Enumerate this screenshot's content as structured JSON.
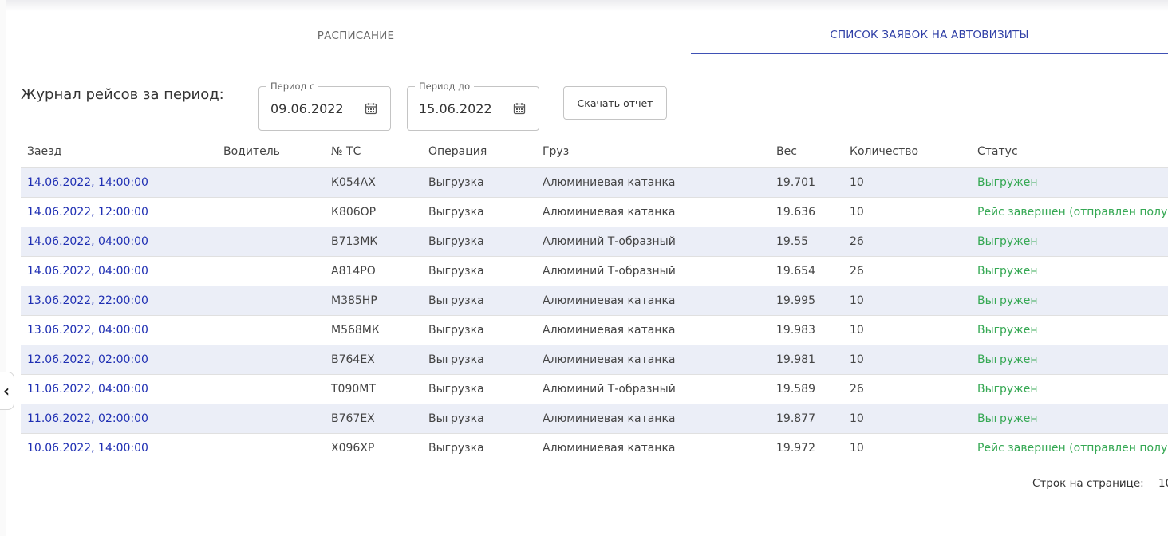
{
  "tabs": [
    {
      "label": "РАСПИСАНИЕ"
    },
    {
      "label": "СПИСОК ЗАЯВОК НА АВТОВИЗИТЫ"
    }
  ],
  "journal": {
    "title": "Журнал рейсов за период:"
  },
  "period_from": {
    "label": "Период с",
    "value": "09.06.2022"
  },
  "period_to": {
    "label": "Период до",
    "value": "15.06.2022"
  },
  "download_label": "Скачать отчет",
  "table": {
    "headers": [
      "Заезд",
      "Водитель",
      "№ ТС",
      "Операция",
      "Груз",
      "Вес",
      "Количество",
      "Статус"
    ],
    "rows": [
      {
        "arrival": "14.06.2022, 14:00:00",
        "driver": "",
        "vehicle": "К054АХ",
        "operation": "Выгрузка",
        "cargo": "Алюминиевая катанка",
        "weight": "19.701",
        "quantity": "10",
        "status": "Выгружен"
      },
      {
        "arrival": "14.06.2022, 12:00:00",
        "driver": "",
        "vehicle": "К806ОР",
        "operation": "Выгрузка",
        "cargo": "Алюминиевая катанка",
        "weight": "19.636",
        "quantity": "10",
        "status": "Рейс завершен (отправлен полу"
      },
      {
        "arrival": "14.06.2022, 04:00:00",
        "driver": "",
        "vehicle": "В713МК",
        "operation": "Выгрузка",
        "cargo": "Алюминий Т-образный",
        "weight": "19.55",
        "quantity": "26",
        "status": "Выгружен"
      },
      {
        "arrival": "14.06.2022, 04:00:00",
        "driver": "",
        "vehicle": "А814РО",
        "operation": "Выгрузка",
        "cargo": "Алюминий Т-образный",
        "weight": "19.654",
        "quantity": "26",
        "status": "Выгружен"
      },
      {
        "arrival": "13.06.2022, 22:00:00",
        "driver": "",
        "vehicle": "М385НР",
        "operation": "Выгрузка",
        "cargo": "Алюминиевая катанка",
        "weight": "19.995",
        "quantity": "10",
        "status": "Выгружен"
      },
      {
        "arrival": "13.06.2022, 04:00:00",
        "driver": "",
        "vehicle": "М568МК",
        "operation": "Выгрузка",
        "cargo": "Алюминиевая катанка",
        "weight": "19.983",
        "quantity": "10",
        "status": "Выгружен"
      },
      {
        "arrival": "12.06.2022, 02:00:00",
        "driver": "",
        "vehicle": "В764ЕХ",
        "operation": "Выгрузка",
        "cargo": "Алюминиевая катанка",
        "weight": "19.981",
        "quantity": "10",
        "status": "Выгружен"
      },
      {
        "arrival": "11.06.2022, 04:00:00",
        "driver": "",
        "vehicle": "Т090МТ",
        "operation": "Выгрузка",
        "cargo": "Алюминий Т-образный",
        "weight": "19.589",
        "quantity": "26",
        "status": "Выгружен"
      },
      {
        "arrival": "11.06.2022, 02:00:00",
        "driver": "",
        "vehicle": "В767ЕХ",
        "operation": "Выгрузка",
        "cargo": "Алюминиевая катанка",
        "weight": "19.877",
        "quantity": "10",
        "status": "Выгружен"
      },
      {
        "arrival": "10.06.2022, 14:00:00",
        "driver": "",
        "vehicle": "Х096ХР",
        "operation": "Выгрузка",
        "cargo": "Алюминиевая катанка",
        "weight": "19.972",
        "quantity": "10",
        "status": "Рейс завершен (отправлен полу"
      }
    ]
  },
  "pagination": {
    "rows_per_page_label": "Строк на странице:",
    "rows_per_page_value": "10"
  },
  "sidebar_toggle": {
    "glyph": "‹",
    "icon": "chevron-left-icon"
  },
  "colors": {
    "accent": "#3f51b5",
    "link": "#1f2fb3",
    "status": "#35a853",
    "row_stripe": "#ebeef7"
  }
}
